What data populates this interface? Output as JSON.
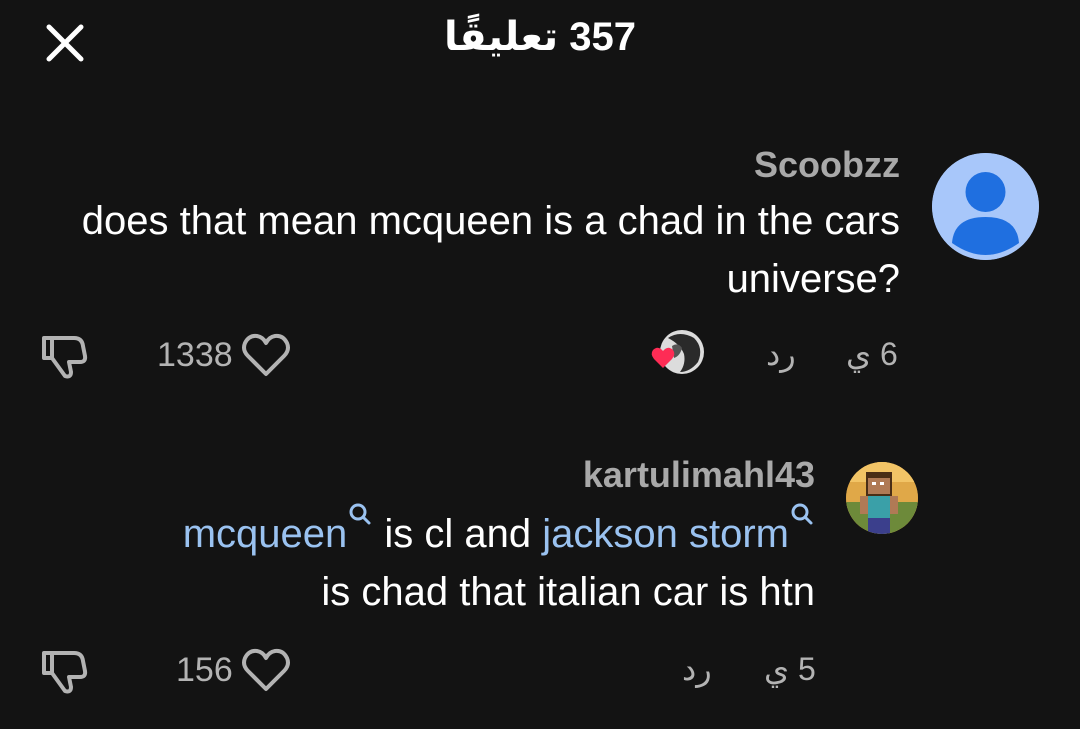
{
  "header": {
    "title": "357 تعليقًا",
    "close_icon": "close-icon"
  },
  "comments": [
    {
      "username": "Scoobzz",
      "avatar": "default-user-avatar",
      "text": "does that mean mcqueen is a chad in the cars universe?",
      "likes": "1338",
      "reply_label": "رد",
      "time": "6 ي",
      "creator_liked": true
    },
    {
      "username": "kartulimahl43",
      "avatar": "minecraft-steve-avatar",
      "mention1": "mcqueen",
      "text_mid": " is cl and ",
      "mention2": "jackson storm",
      "text_end": "is chad that italian car is htn",
      "likes": "156",
      "reply_label": "رد",
      "time": "5 ي"
    }
  ],
  "colors": {
    "background": "#131313",
    "mention": "#9ac2f0",
    "muted": "#b3b3b3",
    "heart": "#fe2c55"
  }
}
